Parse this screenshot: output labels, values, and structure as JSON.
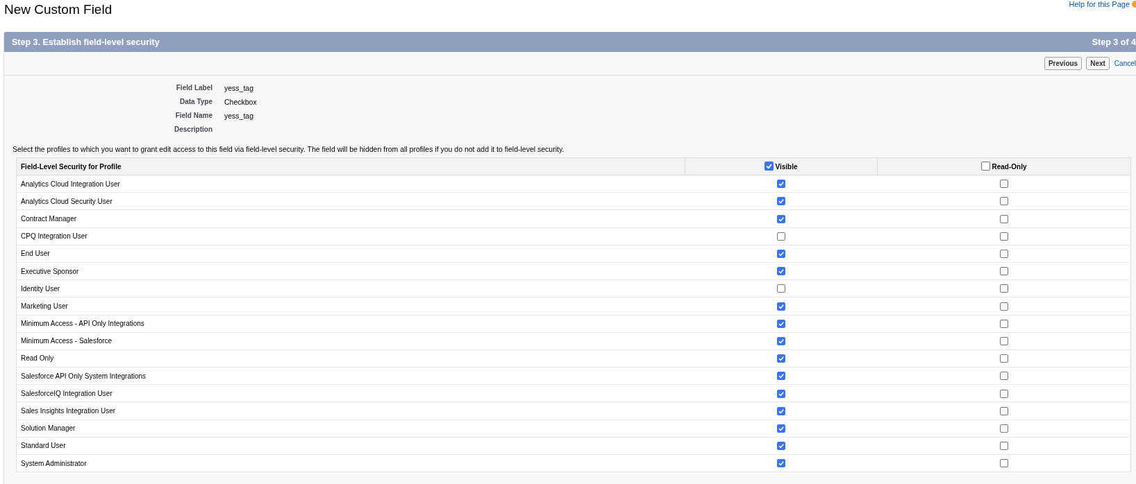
{
  "page": {
    "title": "New Custom Field",
    "help_link": "Help for this Page"
  },
  "step_bar": {
    "title": "Step 3. Establish field-level security",
    "step": "Step 3 of 4"
  },
  "buttons": [
    {
      "label": "Previous",
      "kind": "button"
    },
    {
      "label": "Next",
      "kind": "button"
    },
    {
      "label": "Cancel",
      "kind": "link"
    }
  ],
  "details": [
    {
      "label": "Field Label",
      "value": "yess_tag"
    },
    {
      "label": "Data Type",
      "value": "Checkbox"
    },
    {
      "label": "Field Name",
      "value": "yess_tag"
    },
    {
      "label": "Description"
    }
  ],
  "instructions": "Select the profiles to which you want to grant edit access to this field via field-level security. The field will be hidden from all profiles if you do not add it to field-level security.",
  "table": {
    "columns": [
      {
        "label": "Field-Level Security for Profile"
      },
      {
        "label": "Visible",
        "checked": true
      },
      {
        "label": "Read-Only",
        "checked": false
      }
    ],
    "rows": [
      {
        "profile": "Analytics Cloud Integration User",
        "visible": true,
        "read_only": false
      },
      {
        "profile": "Analytics Cloud Security User",
        "visible": true,
        "read_only": false
      },
      {
        "profile": "Contract Manager",
        "visible": true,
        "read_only": false
      },
      {
        "profile": "CPQ Integration User",
        "visible": false,
        "read_only": false
      },
      {
        "profile": "End User",
        "visible": true,
        "read_only": false
      },
      {
        "profile": "Executive Sponsor",
        "visible": true,
        "read_only": false
      },
      {
        "profile": "Identity User",
        "visible": false,
        "read_only": false
      },
      {
        "profile": "Marketing User",
        "visible": true,
        "read_only": false
      },
      {
        "profile": "Minimum Access - API Only Integrations",
        "visible": true,
        "read_only": false
      },
      {
        "profile": "Minimum Access - Salesforce",
        "visible": true,
        "read_only": false
      },
      {
        "profile": "Read Only",
        "visible": true,
        "read_only": false
      },
      {
        "profile": "Salesforce API Only System Integrations",
        "visible": true,
        "read_only": false
      },
      {
        "profile": "SalesforceIQ Integration User",
        "visible": true,
        "read_only": false
      },
      {
        "profile": "Sales Insights Integration User",
        "visible": true,
        "read_only": false
      },
      {
        "profile": "Solution Manager",
        "visible": true,
        "read_only": false
      },
      {
        "profile": "Standard User",
        "visible": true,
        "read_only": false
      },
      {
        "profile": "System Administrator",
        "visible": true,
        "read_only": false
      }
    ]
  }
}
